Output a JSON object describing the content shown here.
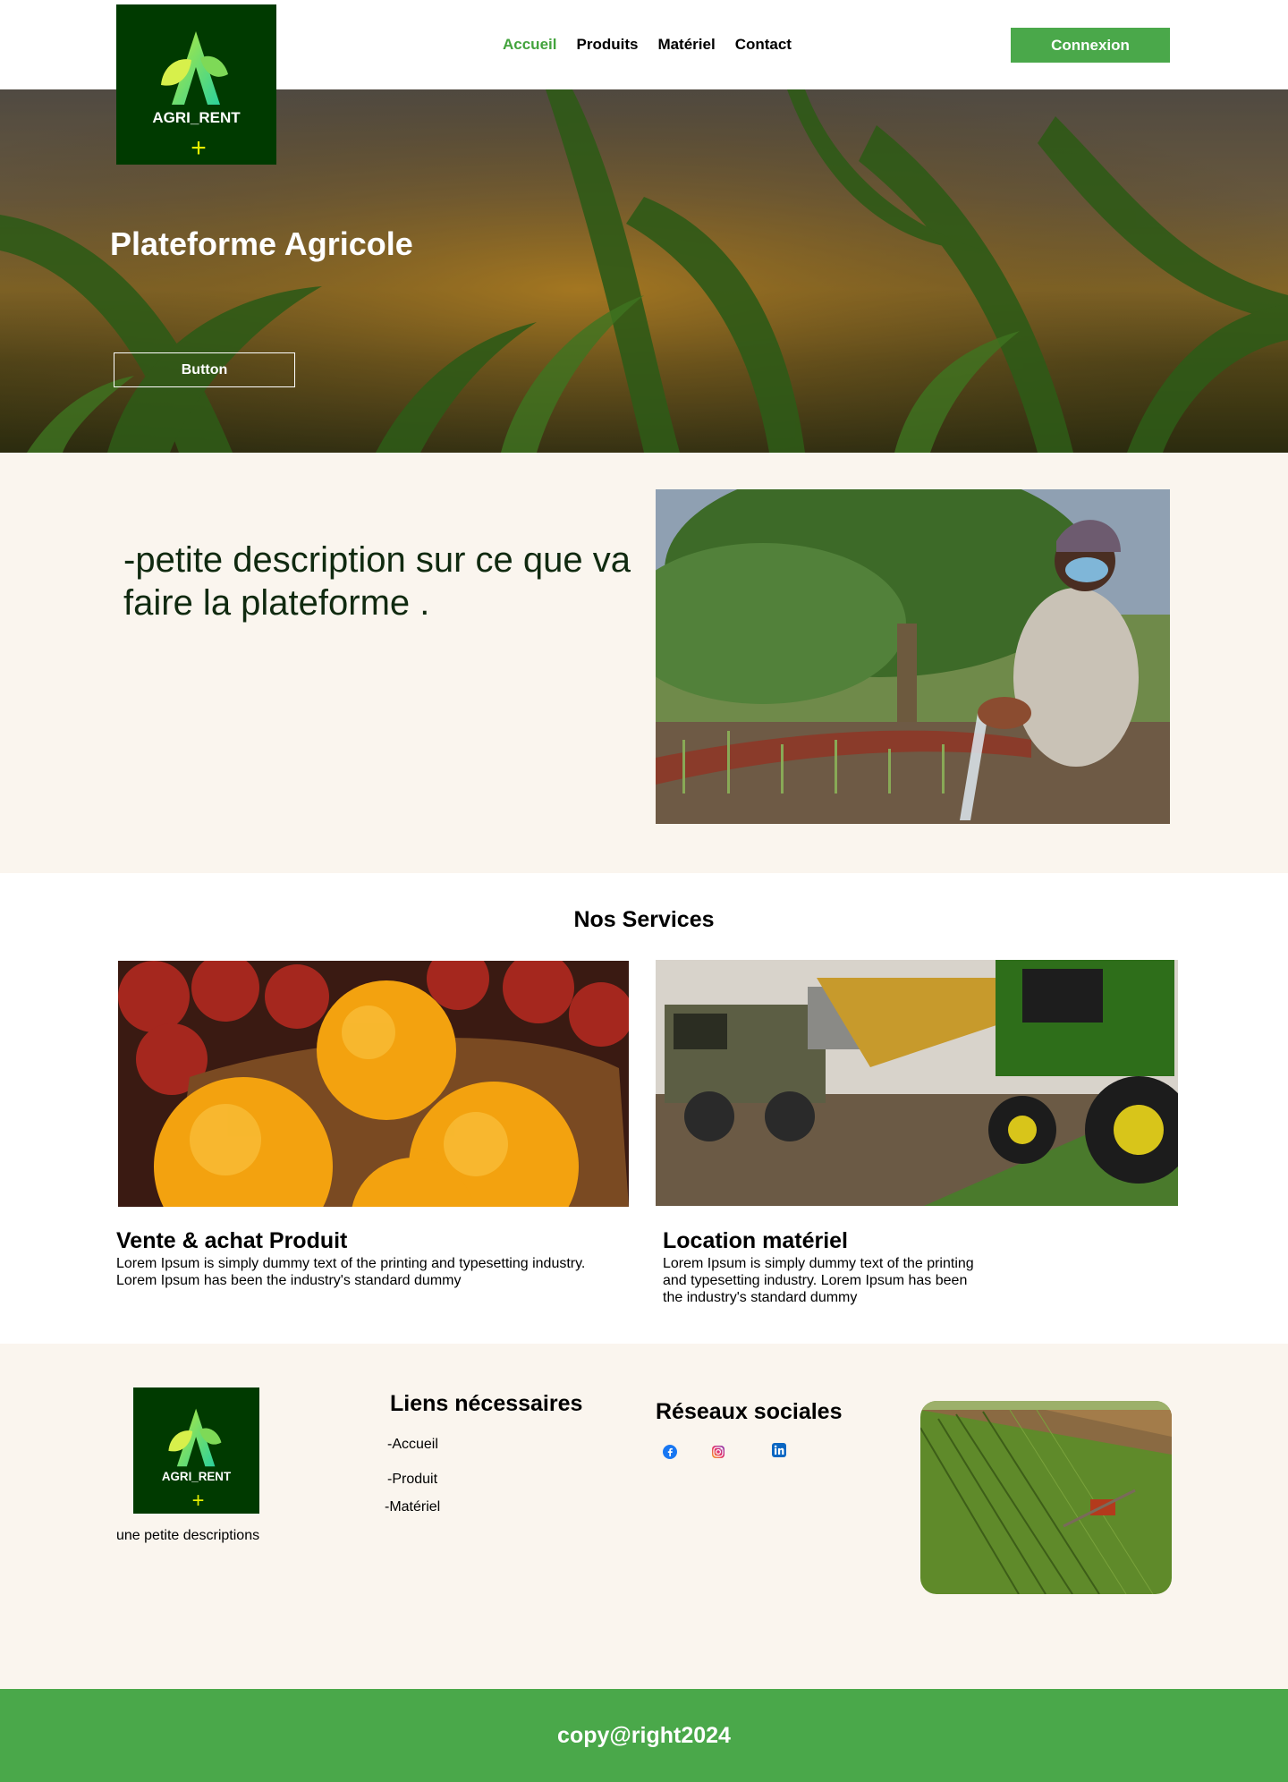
{
  "header": {
    "logo_text": "AGRI_RENT",
    "logo_plus": "+",
    "nav": [
      {
        "label": "Accueil",
        "active": true
      },
      {
        "label": "Produits"
      },
      {
        "label": "Matériel"
      },
      {
        "label": "Contact"
      }
    ],
    "login_label": "Connexion"
  },
  "hero": {
    "title": "Plateforme Agricole",
    "button_label": "Button"
  },
  "intro": {
    "text": "-petite description sur ce que va faire la plateforme ."
  },
  "services": {
    "title": "Nos Services",
    "cards": [
      {
        "title": "Vente & achat Produit",
        "text_lines": [
          "Lorem Ipsum is simply dummy text of the printing and typesetting industry.",
          "Lorem Ipsum has been the industry's standard dummy"
        ]
      },
      {
        "title": "Location matériel",
        "text_lines": [
          "Lorem Ipsum is simply dummy text of the printing",
          "and typesetting industry. Lorem Ipsum has been",
          "the industry's standard dummy"
        ]
      }
    ]
  },
  "footer": {
    "logo_text": "AGRI_RENT",
    "logo_plus": "+",
    "description": "une petite descriptions",
    "links_title": "Liens nécessaires",
    "links": [
      "-Accueil",
      "-Produit",
      "-Matériel"
    ],
    "social_title": "Réseaux sociales",
    "social": [
      "facebook-icon",
      "instagram-icon",
      "linkedin-icon"
    ],
    "copyright": "copy@right2024"
  },
  "colors": {
    "brand_green": "#4aa84a",
    "logo_bg": "#003a00",
    "cream": "#faf5ee"
  }
}
